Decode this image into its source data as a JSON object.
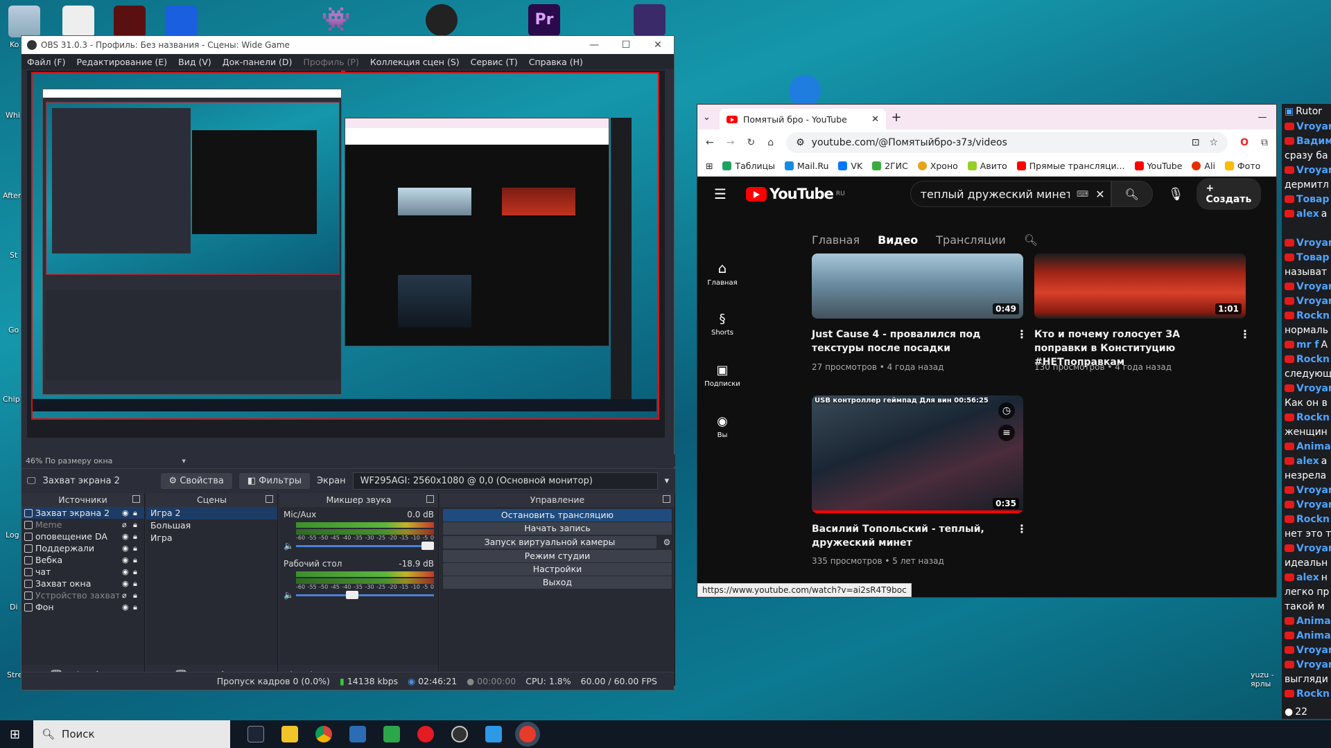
{
  "desktop": {
    "labels": [
      "Ko",
      "Whi",
      "Aften",
      "St",
      "Go Ch",
      "Chip - Res",
      "Log",
      "Di",
      "Stre Re",
      "yuzu - ярлы"
    ]
  },
  "obs": {
    "title": "OBS 31.0.3 - Профиль: Без названия - Сцены: Wide Game",
    "menu": [
      "Файл (F)",
      "Редактирование (E)",
      "Вид (V)",
      "Док-панели (D)",
      "Профиль (P)",
      "Коллекция сцен (S)",
      "Сервис (T)",
      "Справка (H)"
    ],
    "zoom_label": "46% По размеру окна",
    "source_bar": {
      "current": "Захват экрана 2",
      "props": "Свойства",
      "filters": "Фильтры",
      "screen_label": "Экран",
      "screen_value": "WF295AGI: 2560x1080 @ 0,0 (Основной монитор)"
    },
    "docks": {
      "sources_title": "Источники",
      "scenes_title": "Сцены",
      "mixer_title": "Микшер звука",
      "controls_title": "Управление"
    },
    "sources": [
      {
        "name": "Захват экрана 2",
        "selected": true,
        "hidden": false
      },
      {
        "name": "Meme",
        "selected": false,
        "hidden": true
      },
      {
        "name": "оповещение DA",
        "selected": false,
        "hidden": false
      },
      {
        "name": "Поддержали",
        "selected": false,
        "hidden": false
      },
      {
        "name": "Вебка",
        "selected": false,
        "hidden": false
      },
      {
        "name": "чат",
        "selected": false,
        "hidden": false
      },
      {
        "name": "Захват окна",
        "selected": false,
        "hidden": false
      },
      {
        "name": "Устройство захвата",
        "selected": false,
        "hidden": true
      },
      {
        "name": "Фон",
        "selected": false,
        "hidden": false
      }
    ],
    "scenes": [
      {
        "name": "Игра 2",
        "selected": true
      },
      {
        "name": "Большая",
        "selected": false
      },
      {
        "name": "Игра",
        "selected": false
      }
    ],
    "mixer": {
      "scale": [
        "-60",
        "-55",
        "-50",
        "-45",
        "-40",
        "-35",
        "-30",
        "-25",
        "-20",
        "-15",
        "-10",
        "-5",
        "0"
      ],
      "channels": [
        {
          "name": "Mic/Aux",
          "db": "0.0 dB",
          "level": 1.0
        },
        {
          "name": "Рабочий стол",
          "db": "-18.9 dB",
          "level": 0.45
        }
      ]
    },
    "controls": [
      "Остановить трансляцию",
      "Начать запись",
      "Запуск виртуальной камеры",
      "Режим студии",
      "Настройки",
      "Выход"
    ],
    "status": {
      "dropped": "Пропуск кадров 0 (0.0%)",
      "bitrate": "14138 kbps",
      "live_time": "02:46:21",
      "rec_time": "00:00:00",
      "cpu": "CPU: 1.8%",
      "fps": "60.00 / 60.00 FPS"
    }
  },
  "browser": {
    "tab_title": "Помятый бро - YouTube",
    "url": "youtube.com/@Помятыйбро-з7з/videos",
    "bookmarks": [
      "Таблицы",
      "Mail.Ru",
      "VK",
      "2ГИС",
      "Хроно",
      "Авито",
      "Прямые трансляци...",
      "YouTube",
      "Ali",
      "Фото"
    ],
    "status_url": "https://www.youtube.com/watch?v=ai2sR4T9boc"
  },
  "youtube": {
    "logo": "YouTube",
    "logo_region": "RU",
    "search_query": "теплый дружеский минет",
    "create": "Создать",
    "side": [
      "Главная",
      "Shorts",
      "Подписки",
      "Вы"
    ],
    "tabs": [
      "Главная",
      "Видео",
      "Трансляции"
    ],
    "active_tab": "Видео",
    "videos": [
      {
        "title": "Just Cause 4 - провалился под текстуры после посадки",
        "meta": "27 просмотров • 4 года назад",
        "duration": "0:49"
      },
      {
        "title": "Кто и почему голосует ЗА поправки в Конституцию #НЕТпоправкам",
        "meta": "130 просмотров • 4 года назад",
        "duration": "1:01"
      },
      {
        "title": "Василий Топольский - теплый, дружеский минет",
        "meta": "335 просмотров • 5 лет назад",
        "duration": "0:35",
        "overlay_title": "USB контроллер геймпад Для вин 00:56:25"
      }
    ]
  },
  "chat": {
    "header": "Rutor",
    "rows": [
      {
        "n": "Vroyar",
        "t": ""
      },
      {
        "n": "Вадим",
        "t": ""
      },
      {
        "n": "",
        "t": "сразу ба"
      },
      {
        "n": "Vroyar",
        "t": ""
      },
      {
        "n": "",
        "t": "дермитл"
      },
      {
        "n": "Товар",
        "t": ""
      },
      {
        "n": "alex",
        "t": "а"
      },
      {
        "n": "",
        "t": ""
      },
      {
        "n": "Vroyar",
        "t": ""
      },
      {
        "n": "Товар",
        "t": ""
      },
      {
        "n": "",
        "t": "называт"
      },
      {
        "n": "Vroyar",
        "t": ""
      },
      {
        "n": "Vroyar",
        "t": ""
      },
      {
        "n": "Rockn",
        "t": ""
      },
      {
        "n": "",
        "t": "нормаль"
      },
      {
        "n": "mr f",
        "t": "A"
      },
      {
        "n": "Rockn",
        "t": ""
      },
      {
        "n": "",
        "t": "следующ"
      },
      {
        "n": "Vroyar",
        "t": ""
      },
      {
        "n": "",
        "t": "Как он в"
      },
      {
        "n": "Rockn",
        "t": ""
      },
      {
        "n": "",
        "t": "женщин"
      },
      {
        "n": "Anima",
        "t": ""
      },
      {
        "n": "alex",
        "t": "а"
      },
      {
        "n": "",
        "t": "незрела"
      },
      {
        "n": "Vroyar",
        "t": ""
      },
      {
        "n": "Vroyar",
        "t": ""
      },
      {
        "n": "Rockn",
        "t": ""
      },
      {
        "n": "",
        "t": "нет это т"
      },
      {
        "n": "Vroyar",
        "t": ""
      },
      {
        "n": "",
        "t": "идеальн"
      },
      {
        "n": "alex",
        "t": "н"
      },
      {
        "n": "",
        "t": "легко пр"
      },
      {
        "n": "",
        "t": "такой м"
      },
      {
        "n": "Anima",
        "t": ""
      },
      {
        "n": "Anima",
        "t": ""
      },
      {
        "n": "Vroyar",
        "t": ""
      },
      {
        "n": "Vroyar",
        "t": ""
      },
      {
        "n": "",
        "t": "выгляди"
      },
      {
        "n": "Rockn",
        "t": ""
      }
    ],
    "footer": "22"
  },
  "taskbar": {
    "search": "Поиск"
  },
  "colors": {
    "obs_bg": "#2b2e38",
    "obs_selected": "#1c3c66",
    "yt_red": "#ff0000",
    "preview_border": "#dd1111"
  }
}
